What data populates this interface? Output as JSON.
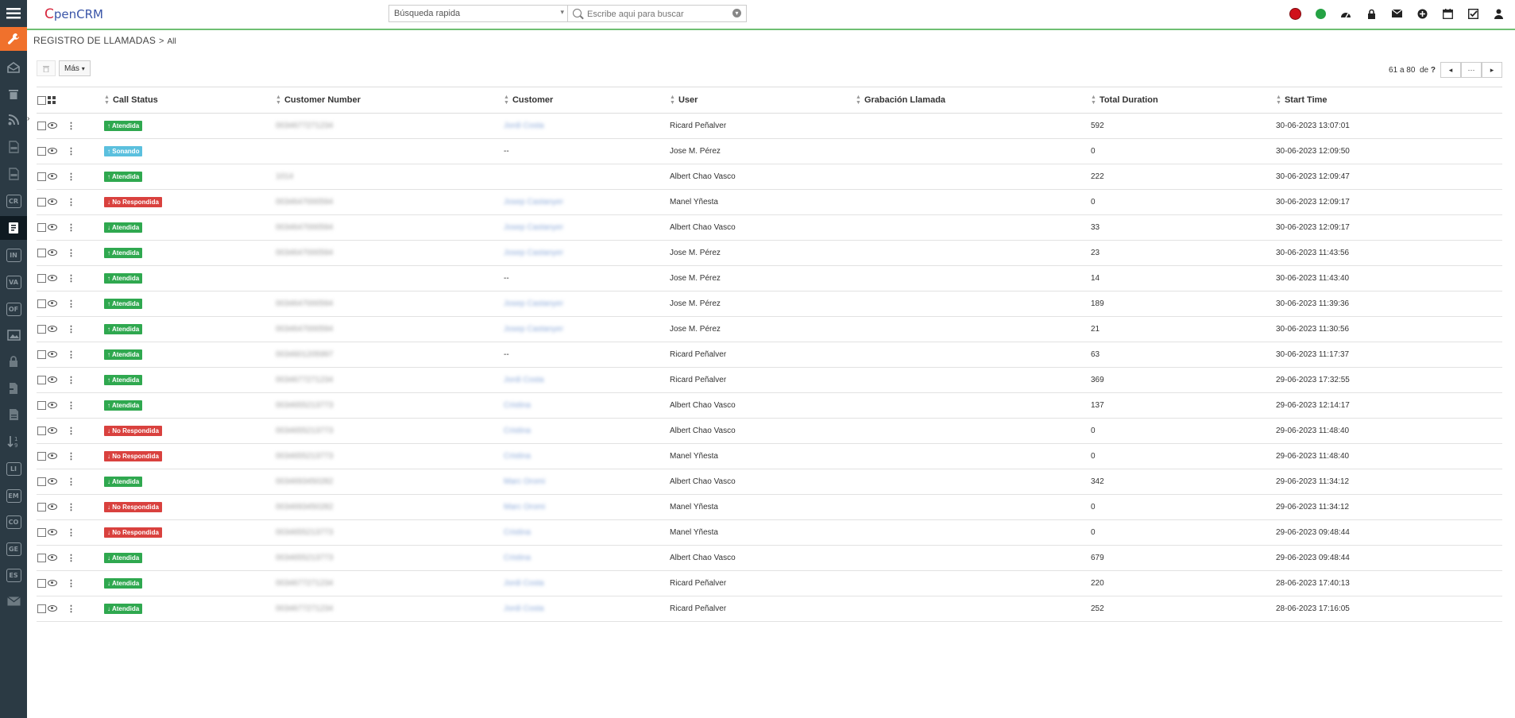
{
  "app": {
    "logo_c": "C",
    "logo_rest": "pen",
    "logo_crm": "CRM"
  },
  "search": {
    "type_label": "Búsqueda rapida",
    "placeholder": "Escribe aqui para buscar"
  },
  "breadcrumb": {
    "module": "REGISTRO DE LLAMADAS",
    "separator": ">",
    "view": "All"
  },
  "toolbar": {
    "more_label": "Más"
  },
  "pagination": {
    "range": "61 a 80",
    "of_label": "de",
    "total": "?",
    "more": "···"
  },
  "sidebar": {
    "boxed_items": [
      "CR",
      "IN",
      "VA",
      "OF",
      "LI",
      "EM",
      "CO",
      "GE",
      "ES"
    ]
  },
  "columns": [
    "Call Status",
    "Customer Number",
    "Customer",
    "User",
    "Grabación Llamada",
    "Total Duration",
    "Start Time"
  ],
  "status_colors": {
    "Atendida": "#2fa84f",
    "No Respondida": "#d9413e",
    "Sonando": "#5bc0de"
  },
  "rows": [
    {
      "status": "Atendida",
      "direction": "out",
      "number": "0034677271234",
      "customer": "Jordi Costa",
      "user": "Ricard Peñalver",
      "recording": "",
      "duration": "592",
      "start": "30-06-2023 13:07:01"
    },
    {
      "status": "Sonando",
      "direction": "out",
      "number": "",
      "customer": "--",
      "user": "Jose M. Pérez",
      "recording": "",
      "duration": "0",
      "start": "30-06-2023 12:09:50"
    },
    {
      "status": "Atendida",
      "direction": "out",
      "number": "1014",
      "customer": "",
      "user": "Albert Chao Vasco",
      "recording": "",
      "duration": "222",
      "start": "30-06-2023 12:09:47"
    },
    {
      "status": "No Respondida",
      "direction": "in",
      "number": "0034647000594",
      "customer": "Josep Castanyer",
      "user": "Manel Yñesta",
      "recording": "",
      "duration": "0",
      "start": "30-06-2023 12:09:17"
    },
    {
      "status": "Atendida",
      "direction": "in",
      "number": "0034647000594",
      "customer": "Josep Castanyer",
      "user": "Albert Chao Vasco",
      "recording": "",
      "duration": "33",
      "start": "30-06-2023 12:09:17"
    },
    {
      "status": "Atendida",
      "direction": "out",
      "number": "0034647000594",
      "customer": "Josep Castanyer",
      "user": "Jose M. Pérez",
      "recording": "",
      "duration": "23",
      "start": "30-06-2023 11:43:56"
    },
    {
      "status": "Atendida",
      "direction": "out",
      "number": "",
      "customer": "--",
      "user": "Jose M. Pérez",
      "recording": "",
      "duration": "14",
      "start": "30-06-2023 11:43:40"
    },
    {
      "status": "Atendida",
      "direction": "out",
      "number": "0034647000594",
      "customer": "Josep Castanyer",
      "user": "Jose M. Pérez",
      "recording": "",
      "duration": "189",
      "start": "30-06-2023 11:39:36"
    },
    {
      "status": "Atendida",
      "direction": "out",
      "number": "0034647000594",
      "customer": "Josep Castanyer",
      "user": "Jose M. Pérez",
      "recording": "",
      "duration": "21",
      "start": "30-06-2023 11:30:56"
    },
    {
      "status": "Atendida",
      "direction": "out",
      "number": "0034601205997",
      "customer": "--",
      "user": "Ricard Peñalver",
      "recording": "",
      "duration": "63",
      "start": "30-06-2023 11:17:37"
    },
    {
      "status": "Atendida",
      "direction": "out",
      "number": "0034677271234",
      "customer": "Jordi Costa",
      "user": "Ricard Peñalver",
      "recording": "",
      "duration": "369",
      "start": "29-06-2023 17:32:55"
    },
    {
      "status": "Atendida",
      "direction": "out",
      "number": "0034655213773",
      "customer": "Cristina",
      "user": "Albert Chao Vasco",
      "recording": "",
      "duration": "137",
      "start": "29-06-2023 12:14:17"
    },
    {
      "status": "No Respondida",
      "direction": "in",
      "number": "0034655213773",
      "customer": "Cristina",
      "user": "Albert Chao Vasco",
      "recording": "",
      "duration": "0",
      "start": "29-06-2023 11:48:40"
    },
    {
      "status": "No Respondida",
      "direction": "in",
      "number": "0034655213773",
      "customer": "Cristina",
      "user": "Manel Yñesta",
      "recording": "",
      "duration": "0",
      "start": "29-06-2023 11:48:40"
    },
    {
      "status": "Atendida",
      "direction": "in",
      "number": "0034693450282",
      "customer": "Marc Oromi",
      "user": "Albert Chao Vasco",
      "recording": "",
      "duration": "342",
      "start": "29-06-2023 11:34:12"
    },
    {
      "status": "No Respondida",
      "direction": "in",
      "number": "0034693450282",
      "customer": "Marc Oromi",
      "user": "Manel Yñesta",
      "recording": "",
      "duration": "0",
      "start": "29-06-2023 11:34:12"
    },
    {
      "status": "No Respondida",
      "direction": "in",
      "number": "0034655213773",
      "customer": "Cristina",
      "user": "Manel Yñesta",
      "recording": "",
      "duration": "0",
      "start": "29-06-2023 09:48:44"
    },
    {
      "status": "Atendida",
      "direction": "in",
      "number": "0034655213773",
      "customer": "Cristina",
      "user": "Albert Chao Vasco",
      "recording": "",
      "duration": "679",
      "start": "29-06-2023 09:48:44"
    },
    {
      "status": "Atendida",
      "direction": "in",
      "number": "0034677271234",
      "customer": "Jordi Costa",
      "user": "Ricard Peñalver",
      "recording": "",
      "duration": "220",
      "start": "28-06-2023 17:40:13"
    },
    {
      "status": "Atendida",
      "direction": "in",
      "number": "0034677271234",
      "customer": "Jordi Costa",
      "user": "Ricard Peñalver",
      "recording": "",
      "duration": "252",
      "start": "28-06-2023 17:16:05"
    }
  ]
}
